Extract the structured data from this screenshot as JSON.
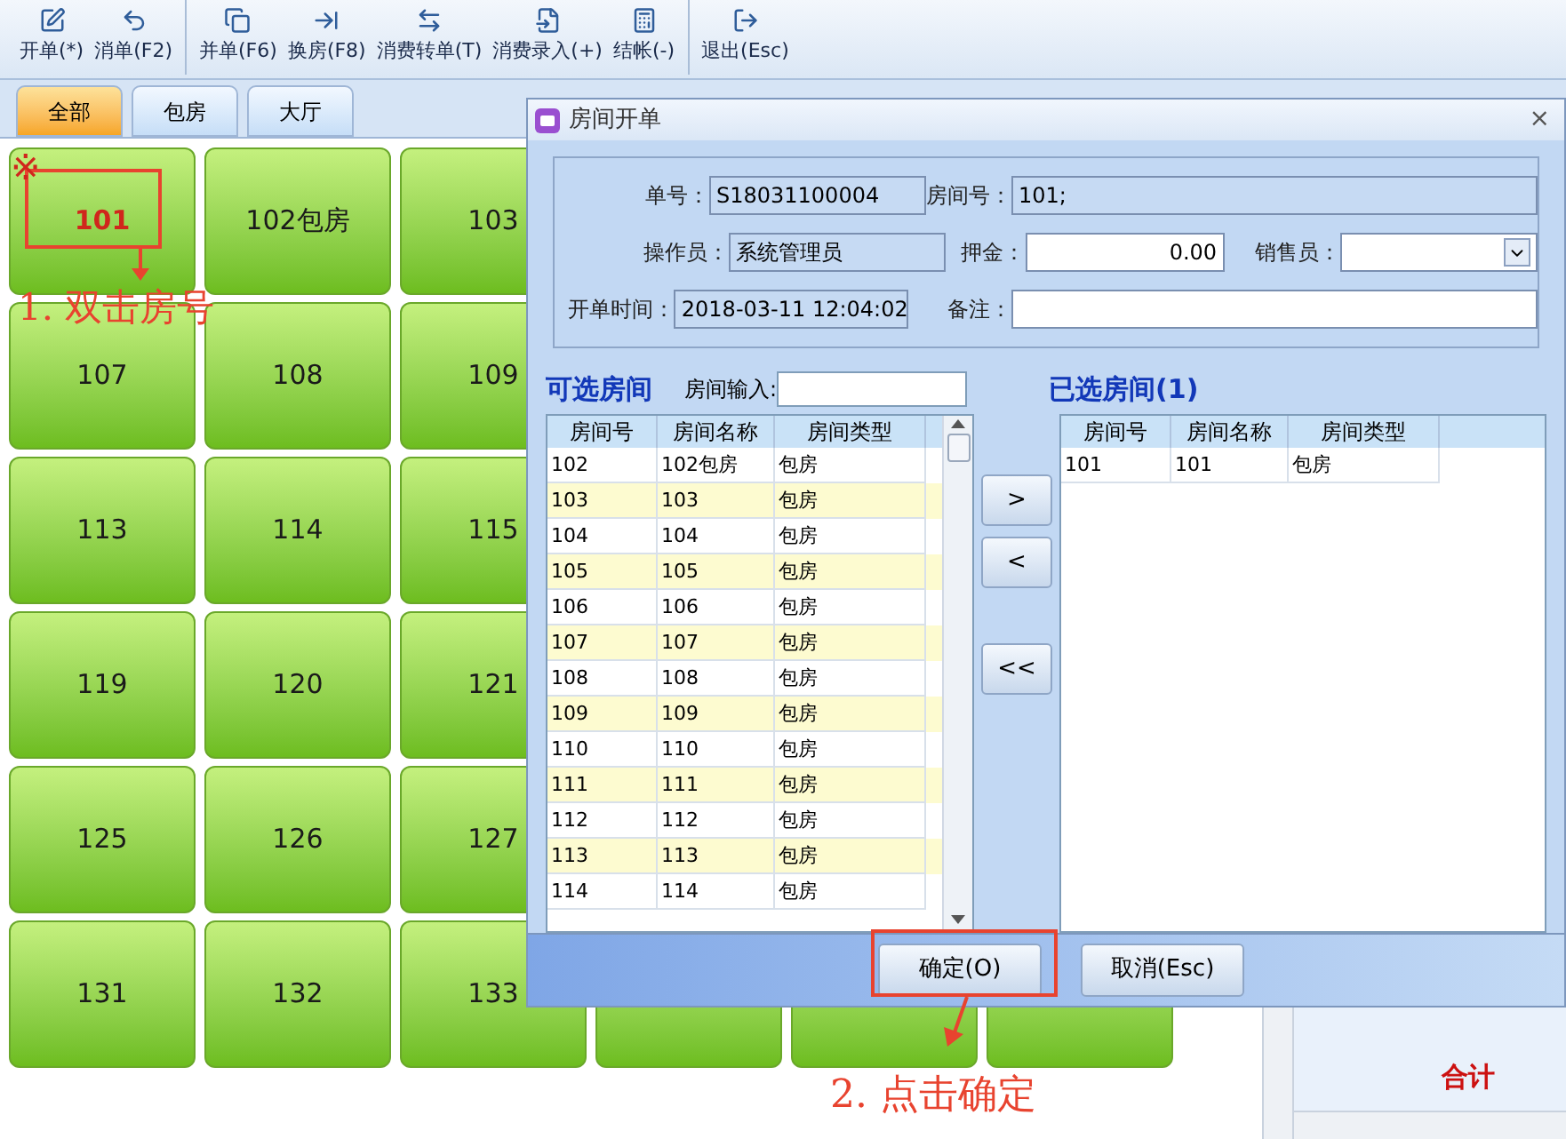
{
  "toolbar": {
    "groups": [
      [
        {
          "label": "开单(*)"
        },
        {
          "label": "消单(F2)"
        }
      ],
      [
        {
          "label": "并单(F6)"
        },
        {
          "label": "换房(F8)"
        },
        {
          "label": "消费转单(T)"
        },
        {
          "label": "消费录入(+)"
        },
        {
          "label": "结帐(-)"
        }
      ],
      [
        {
          "label": "退出(Esc)"
        }
      ]
    ]
  },
  "tabs": [
    {
      "label": "全部",
      "selected": true
    },
    {
      "label": "包房",
      "selected": false
    },
    {
      "label": "大厅",
      "selected": false
    }
  ],
  "rooms": [
    [
      {
        "label": "101",
        "selected": true
      },
      {
        "label": "102包房",
        "selected": false
      },
      {
        "label": "103",
        "selected": false
      }
    ],
    [
      {
        "label": "107",
        "selected": false
      },
      {
        "label": "108",
        "selected": false
      },
      {
        "label": "109",
        "selected": false
      }
    ],
    [
      {
        "label": "113",
        "selected": false
      },
      {
        "label": "114",
        "selected": false
      },
      {
        "label": "115",
        "selected": false
      }
    ],
    [
      {
        "label": "119",
        "selected": false
      },
      {
        "label": "120",
        "selected": false
      },
      {
        "label": "121",
        "selected": false
      }
    ],
    [
      {
        "label": "125",
        "selected": false
      },
      {
        "label": "126",
        "selected": false
      },
      {
        "label": "127",
        "selected": false
      }
    ],
    [
      {
        "label": "131",
        "selected": false
      },
      {
        "label": "132",
        "selected": false
      },
      {
        "label": "133",
        "selected": false
      }
    ]
  ],
  "side_panel": {
    "total_label": "合计"
  },
  "dialog": {
    "title": "房间开单",
    "close": "×",
    "fields": {
      "order_no": {
        "label": "单号：",
        "value": "S18031100004"
      },
      "room_no": {
        "label": "房间号：",
        "value": "101;"
      },
      "operator": {
        "label": "操作员：",
        "value": "系统管理员"
      },
      "deposit": {
        "label": "押金：",
        "value": "0.00"
      },
      "salesperson": {
        "label": "销售员："
      },
      "open_time": {
        "label": "开单时间：",
        "value": "2018-03-11 12:04:02"
      },
      "note": {
        "label": "备注："
      }
    },
    "available": {
      "title": "可选房间",
      "search_label": "房间输入:",
      "columns": [
        "房间号",
        "房间名称",
        "房间类型"
      ],
      "rows": [
        [
          "102",
          "102包房",
          "包房"
        ],
        [
          "103",
          "103",
          "包房"
        ],
        [
          "104",
          "104",
          "包房"
        ],
        [
          "105",
          "105",
          "包房"
        ],
        [
          "106",
          "106",
          "包房"
        ],
        [
          "107",
          "107",
          "包房"
        ],
        [
          "108",
          "108",
          "包房"
        ],
        [
          "109",
          "109",
          "包房"
        ],
        [
          "110",
          "110",
          "包房"
        ],
        [
          "111",
          "111",
          "包房"
        ],
        [
          "112",
          "112",
          "包房"
        ],
        [
          "113",
          "113",
          "包房"
        ],
        [
          "114",
          "114",
          "包房"
        ]
      ]
    },
    "move_buttons": [
      ">",
      "<",
      "<<"
    ],
    "selected": {
      "title": "已选房间(1)",
      "columns": [
        "房间号",
        "房间名称",
        "房间类型"
      ],
      "rows": [
        [
          "101",
          "101",
          "包房"
        ]
      ]
    },
    "buttons": [
      {
        "label": "确定(O)"
      },
      {
        "label": "取消(Esc)"
      }
    ]
  },
  "annotations": [
    {
      "mark": "※",
      "text": "1. 双击房号"
    },
    {
      "text": "2. 点击确定"
    }
  ]
}
